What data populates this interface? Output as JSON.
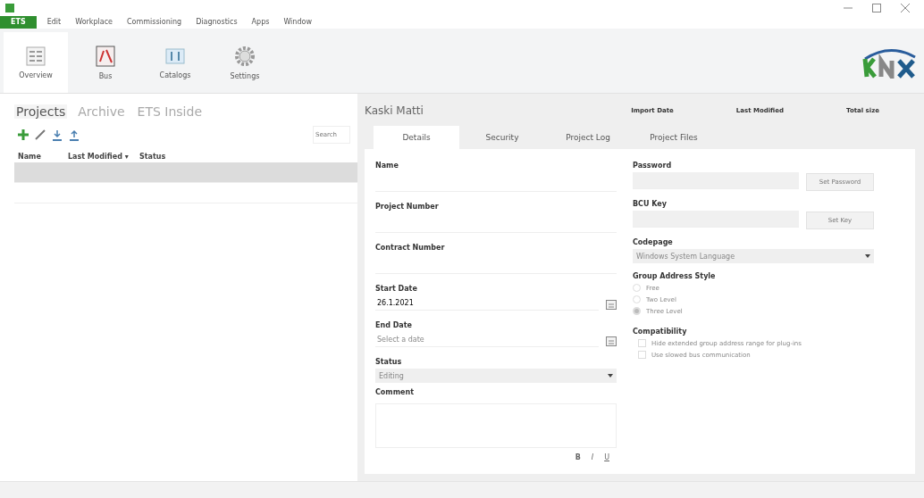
{
  "menu": [
    {
      "label": "ETS",
      "selected": true
    },
    {
      "label": "Edit",
      "selected": false
    },
    {
      "label": "Workplace",
      "selected": false
    },
    {
      "label": "Commissioning",
      "selected": false
    },
    {
      "label": "Diagnostics",
      "selected": false
    },
    {
      "label": "Apps",
      "selected": false
    },
    {
      "label": "Window",
      "selected": false
    }
  ],
  "ribbon": [
    {
      "label": "Overview",
      "kind": "overview",
      "selected": true
    },
    {
      "label": "Bus",
      "kind": "bus",
      "selected": false
    },
    {
      "label": "Catalogs",
      "kind": "catalogs",
      "selected": false
    },
    {
      "label": "Settings",
      "kind": "settings",
      "selected": false
    }
  ],
  "projects_panel": {
    "tabs": [
      {
        "label": "Projects",
        "selected": true
      },
      {
        "label": "Archive",
        "selected": false
      },
      {
        "label": "ETS Inside",
        "selected": false
      }
    ],
    "search": {
      "placeholder": "Search"
    },
    "columns": [
      "Name",
      "Last Modified ▾",
      "Status"
    ],
    "rows": [
      {
        "selected": true
      },
      {
        "selected": false
      }
    ]
  },
  "project": {
    "name": "Kaski Matti",
    "meta": [
      "Import Date",
      "Last Modified",
      "Total size"
    ],
    "tabs": [
      {
        "label": "Details",
        "selected": true
      },
      {
        "label": "Security",
        "selected": false
      },
      {
        "label": "Project Log",
        "selected": false
      },
      {
        "label": "Project Files",
        "selected": false
      }
    ],
    "left_fields": [
      {
        "kind": "text",
        "label": "Name"
      },
      {
        "kind": "text",
        "label": "Project Number"
      },
      {
        "kind": "text",
        "label": "Contract Number"
      },
      {
        "kind": "date",
        "label": "Start Date",
        "value": "26.1.2021"
      },
      {
        "kind": "date",
        "label": "End Date",
        "placeholder": "Select a date"
      },
      {
        "kind": "select",
        "label": "Status",
        "value": "Editing"
      },
      {
        "kind": "textarea",
        "label": "Comment",
        "format_buttons": [
          "B",
          "I",
          "U"
        ]
      }
    ],
    "password": {
      "label": "Password",
      "button": "Set Password"
    },
    "bcu_key": {
      "label": "BCU Key",
      "button": "Set Key"
    },
    "codepage": {
      "label": "Codepage",
      "value": "Windows System Language"
    },
    "group_address_style": {
      "label": "Group Address Style",
      "options": [
        {
          "label": "Free",
          "selected": false
        },
        {
          "label": "Two Level",
          "selected": false
        },
        {
          "label": "Three Level",
          "selected": true
        }
      ]
    },
    "compatibility": {
      "label": "Compatibility",
      "options": [
        {
          "label": "Hide extended group address range for plug-ins",
          "checked": false
        },
        {
          "label": "Use slowed bus communication",
          "checked": false
        }
      ]
    }
  }
}
